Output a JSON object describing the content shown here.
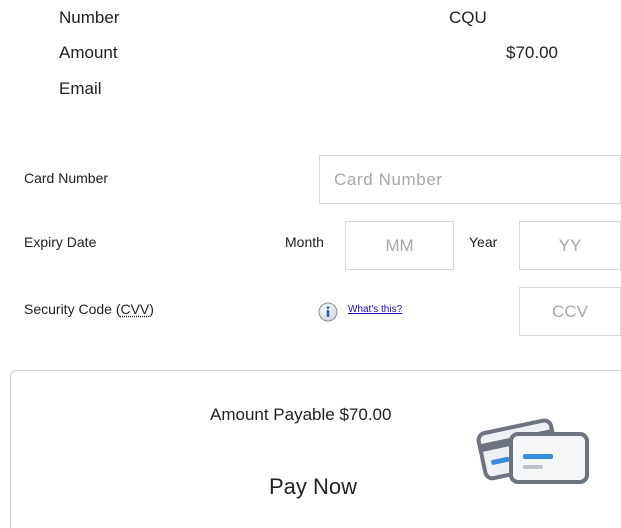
{
  "summary": {
    "rows": [
      {
        "label": "Number",
        "value": "CQU"
      },
      {
        "label": "Amount",
        "value": "$70.00"
      },
      {
        "label": "Email",
        "value": ""
      }
    ]
  },
  "form": {
    "card_number_label": "Card Number",
    "card_number_placeholder": "Card Number",
    "expiry_label": "Expiry Date",
    "month_label": "Month",
    "month_placeholder": "MM",
    "year_label": "Year",
    "year_placeholder": "YY",
    "security_label_prefix": "Security Code (",
    "security_label_abbr": "CVV",
    "security_label_suffix": ")",
    "whats_this_link": "What's this?",
    "ccv_placeholder": "CCV"
  },
  "payment": {
    "amount_payable_text": "Amount Payable $70.00",
    "pay_now_label": "Pay Now"
  },
  "icons": {
    "info": "info-icon",
    "cards": "credit-cards-icon"
  },
  "colors": {
    "link": "#1a0dab",
    "border": "#d7d7d7",
    "placeholder": "#a8a8a8",
    "icon_gray": "#6d7480",
    "icon_blue": "#3a8bdc"
  }
}
